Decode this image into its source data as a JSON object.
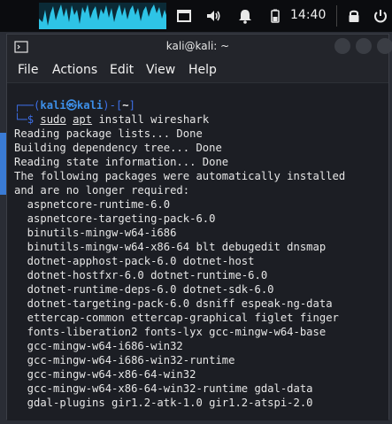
{
  "panel": {
    "clock": "14:40",
    "icons": [
      "window-icon",
      "volume-icon",
      "bell-icon",
      "battery-icon",
      "lock-icon",
      "power-icon"
    ]
  },
  "window": {
    "title": "kali@kali: ~"
  },
  "menu": {
    "items": [
      "File",
      "Actions",
      "Edit",
      "View",
      "Help"
    ]
  },
  "prompt": {
    "open": "┌──(",
    "user": "kali",
    "at": "㉿",
    "host": "kali",
    "close": ")-[",
    "path": "~",
    "end": "]",
    "corner": "└─",
    "dollar": "$",
    "sudo": "sudo",
    "apt": "apt",
    "args": "install wireshark"
  },
  "output": [
    "Reading package lists... Done",
    "Building dependency tree... Done",
    "Reading state information... Done",
    "The following packages were automatically installed",
    "and are no longer required:",
    "  aspnetcore-runtime-6.0",
    "  aspnetcore-targeting-pack-6.0",
    "  binutils-mingw-w64-i686",
    "  binutils-mingw-w64-x86-64 blt debugedit dnsmap",
    "  dotnet-apphost-pack-6.0 dotnet-host",
    "  dotnet-hostfxr-6.0 dotnet-runtime-6.0",
    "  dotnet-runtime-deps-6.0 dotnet-sdk-6.0",
    "  dotnet-targeting-pack-6.0 dsniff espeak-ng-data",
    "  ettercap-common ettercap-graphical figlet finger",
    "  fonts-liberation2 fonts-lyx gcc-mingw-w64-base",
    "  gcc-mingw-w64-i686-win32",
    "  gcc-mingw-w64-i686-win32-runtime",
    "  gcc-mingw-w64-x86-64-win32",
    "  gcc-mingw-w64-x86-64-win32-runtime gdal-data",
    "  gdal-plugins gir1.2-atk-1.0 gir1.2-atspi-2.0"
  ],
  "colors": {
    "accent": "#3d6fe8",
    "cpu_graph": "#2ec4e6"
  }
}
